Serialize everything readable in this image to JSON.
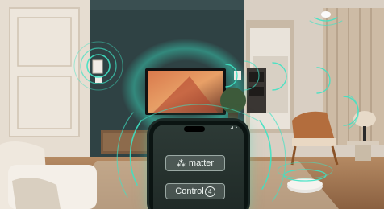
{
  "scene": {
    "description_colors": {
      "accent_glow": "#2fd6b8",
      "wall_dark": "#2c3d3f",
      "wall_light": "#e7dfd4"
    }
  },
  "phone": {
    "status_text": "◢ ▪",
    "matter_label": "matter",
    "matter_icon": "matter-logo-icon",
    "control_label": "Control",
    "control_badge": "4",
    "control_icon": "control4-logo-icon"
  }
}
